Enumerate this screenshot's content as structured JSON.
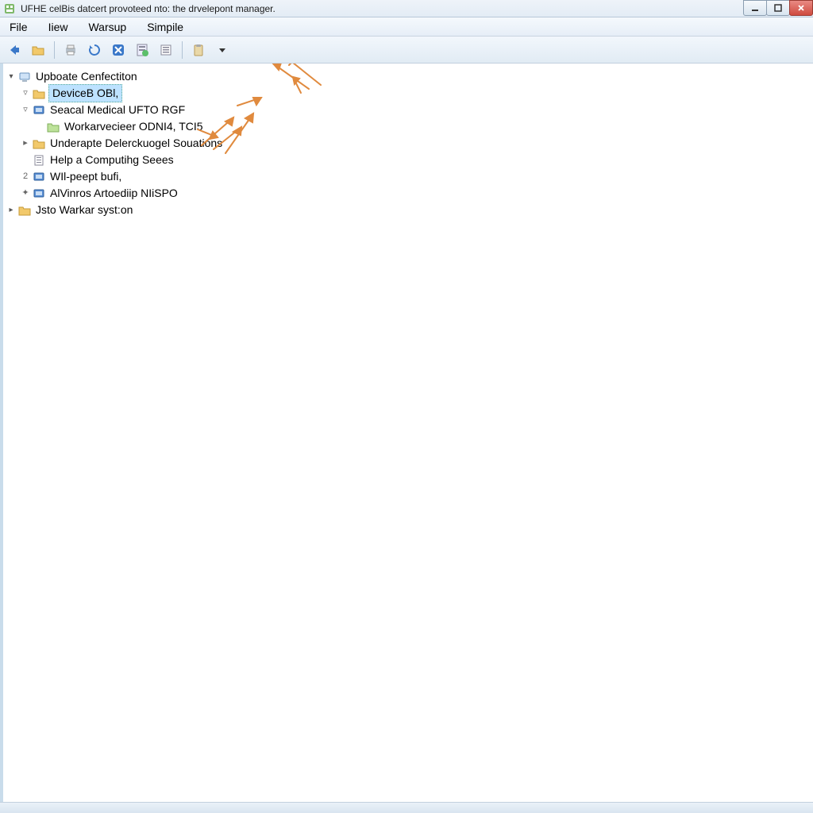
{
  "window": {
    "title": "UFHE celBis datcert provoteed nto: the drvelepont manager."
  },
  "menubar": {
    "items": [
      "File",
      "Iiew",
      "Warsup",
      "Simpile"
    ]
  },
  "toolbar": {
    "buttons": [
      {
        "name": "back-arrow-icon"
      },
      {
        "name": "folder-open-icon"
      },
      {
        "sep": true
      },
      {
        "name": "printer-icon"
      },
      {
        "name": "refresh-icon"
      },
      {
        "name": "delete-x-icon"
      },
      {
        "name": "properties-icon"
      },
      {
        "name": "list-badge-icon"
      },
      {
        "sep": true
      },
      {
        "name": "clipboard-icon"
      },
      {
        "name": "dropdown-arrow-icon"
      }
    ]
  },
  "tree": {
    "root": {
      "label": "Upboate Cenfectiton",
      "expanded": true,
      "children": [
        {
          "label": "DeviceB OBl,",
          "icon": "folder",
          "selected": true,
          "prefix": "▾"
        },
        {
          "label": "Seacal Medical UFTO RGF",
          "icon": "device-blue",
          "prefix": "▾",
          "expanded": true,
          "children": [
            {
              "label": "Workarvecieer ODNI4, TCI5",
              "icon": "folder-green",
              "prefix": ""
            }
          ]
        },
        {
          "label": "Underapte Delerckuogel Souations",
          "icon": "folder",
          "prefix": "▸"
        },
        {
          "label": "Help a Computihg Seees",
          "icon": "sheet",
          "prefix": ""
        },
        {
          "label": "WIl-peept bufi,",
          "icon": "device-blue",
          "prefix": "2"
        },
        {
          "label": "AlVinros Artoediip NIiSPO",
          "icon": "device-blue",
          "prefix": "✦"
        }
      ]
    },
    "second_root": {
      "label": "Jsto Warkar syst:on",
      "icon": "folder",
      "expanded": false
    }
  },
  "colors": {
    "annotation": "#e08a3e"
  }
}
